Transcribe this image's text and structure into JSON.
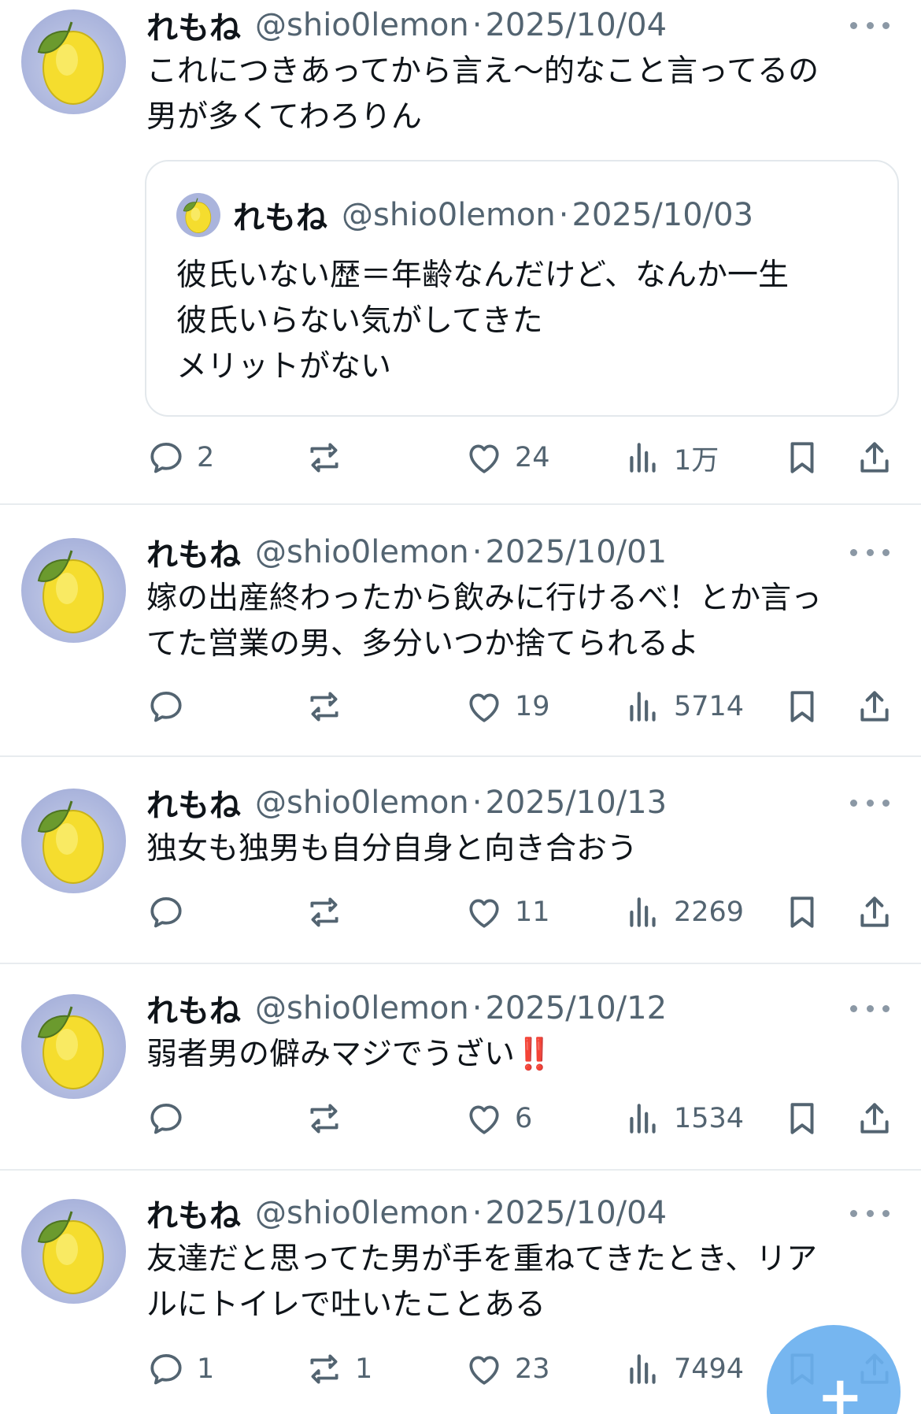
{
  "colors": {
    "accent": "#1d9bf0",
    "text": "#0f1419",
    "muted": "#536471",
    "fab": "#6ab0ef"
  },
  "icons": [
    "lemon-avatar",
    "more-dots-icon",
    "reply-icon",
    "retweet-icon",
    "like-icon",
    "views-icon",
    "bookmark-icon",
    "share-icon",
    "plus-icon"
  ],
  "tweets": [
    {
      "name": "れもね",
      "handle": "@shio0lemon",
      "sep": "·",
      "date": "2025/10/04",
      "text": "これにつきあってから言え〜的なこと言ってるの\n男が多くてわろりん",
      "quote": {
        "name": "れもね",
        "handle": "@shio0lemon",
        "sep": "·",
        "date": "2025/10/03",
        "text": "彼氏いない歴＝年齢なんだけど、なんか一生\n彼氏いらない気がしてきた\nメリットがない"
      },
      "replies": "2",
      "retweets": "",
      "likes": "24",
      "views": "1万"
    },
    {
      "name": "れもね",
      "handle": "@shio0lemon",
      "sep": "·",
      "date": "2025/10/01",
      "text": "嫁の出産終わったから飲みに行けるべ！とか言っ\nてた営業の男、多分いつか捨てられるよ",
      "replies": "",
      "retweets": "",
      "likes": "19",
      "views": "5714"
    },
    {
      "name": "れもね",
      "handle": "@shio0lemon",
      "sep": "·",
      "date": "2025/10/13",
      "text": "独女も独男も自分自身と向き合おう",
      "replies": "",
      "retweets": "",
      "likes": "11",
      "views": "2269"
    },
    {
      "name": "れもね",
      "handle": "@shio0lemon",
      "sep": "·",
      "date": "2025/10/12",
      "text": "弱者男の僻みマジでうざい‼️",
      "replies": "",
      "retweets": "",
      "likes": "6",
      "views": "1534"
    },
    {
      "name": "れもね",
      "handle": "@shio0lemon",
      "sep": "·",
      "date": "2025/10/04",
      "text": "友達だと思ってた男が手を重ねてきたとき、リア\nルにトイレで吐いたことある",
      "replies": "1",
      "retweets": "1",
      "likes": "23",
      "views": "7494"
    }
  ],
  "fab": {
    "label": "+"
  }
}
